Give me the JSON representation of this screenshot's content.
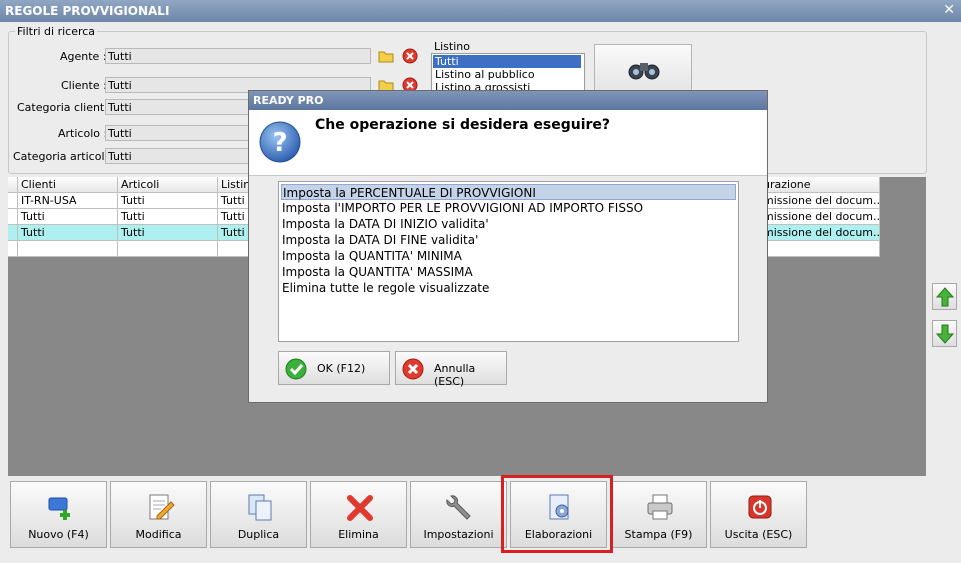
{
  "window": {
    "title": "REGOLE PROVVIGIONALI"
  },
  "filters": {
    "group_title": "Filtri di ricerca",
    "agente": {
      "label": "Agente :",
      "value": "Tutti"
    },
    "cliente": {
      "label": "Cliente :",
      "value": "Tutti"
    },
    "categoria_clienti": {
      "label": "Categoria clienti :",
      "value": "Tutti"
    },
    "articolo": {
      "label": "Articolo :",
      "value": "Tutti"
    },
    "categoria_articoli": {
      "label": "Categoria articoli :",
      "value": "Tutti"
    },
    "listino": {
      "label": "Listino",
      "options": [
        "Tutti",
        "Listino al pubblico",
        "Listino a grossisti"
      ],
      "selected": "Tutti"
    }
  },
  "table": {
    "columns": [
      "Clienti",
      "Articoli",
      "Listino",
      "urazione"
    ],
    "rows": [
      [
        "IT-RN-USA",
        "Tutti",
        "Tutti",
        "missione del docum..."
      ],
      [
        "Tutti",
        "Tutti",
        "Tutti",
        "missione del docum..."
      ],
      [
        "Tutti",
        "Tutti",
        "Tutti",
        "missione del docum..."
      ],
      [
        "",
        "",
        "",
        ""
      ]
    ]
  },
  "toolbar": {
    "nuovo": "Nuovo (F4)",
    "modifica": "Modifica",
    "duplica": "Duplica",
    "elimina": "Elimina",
    "impostazioni": "Impostazioni",
    "elaborazioni": "Elaborazioni",
    "stampa": "Stampa (F9)",
    "uscita": "Uscita (ESC)"
  },
  "dialog": {
    "title": "READY PRO",
    "question": "Che operazione si desidera eseguire?",
    "options": [
      "Imposta la PERCENTUALE DI PROVVIGIONI",
      "Imposta l'IMPORTO PER LE PROVVIGIONI AD IMPORTO FISSO",
      "Imposta la DATA DI INIZIO validita'",
      "Imposta la DATA DI FINE validita'",
      "Imposta la QUANTITA' MINIMA",
      "Imposta la QUANTITA' MASSIMA",
      "Elimina tutte le regole visualizzate"
    ],
    "ok_label": "OK (F12)",
    "cancel_label": "Annulla (ESC)"
  },
  "colors": {
    "title_bar": "#7e95b8",
    "selected_row": "#aef0f0",
    "highlight_border": "#d82020"
  }
}
